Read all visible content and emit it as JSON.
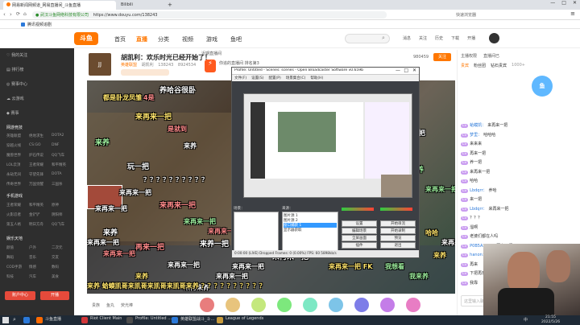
{
  "browser": {
    "tabs": [
      {
        "label": "网易新闻网频道_网易直播间_斗鱼直播"
      },
      {
        "label": "Bilibili"
      }
    ],
    "window_controls": {
      "minimize": "—",
      "maximize": "□",
      "close": "✕"
    },
    "address": {
      "url": "https://www.douyu.com/138243",
      "site_hint": "武汉斗鱼网络科技有限公司"
    },
    "right_hint": "快速浏览器",
    "bookmarks": [
      {
        "label": "腾讯视频追剧"
      }
    ]
  },
  "site": {
    "logo": "斗鱼",
    "nav": [
      "首页",
      "直播",
      "分类",
      "视频",
      "游戏",
      "鱼吧"
    ],
    "search_placeholder": "",
    "user_icons": [
      "消息",
      "关注",
      "历史",
      "下载",
      "开播"
    ]
  },
  "sidebar": {
    "items": [
      {
        "label": "我的关注"
      },
      {
        "label": "排行榜"
      },
      {
        "label": "赛事中心"
      },
      {
        "label": "云游戏"
      },
      {
        "label": "赛事"
      }
    ],
    "section_games": "网游竞技",
    "games": [
      [
        "英雄联盟",
        "绝地求生",
        "DOTA2"
      ],
      [
        "穿越火线",
        "CS:GO",
        "DNF"
      ],
      [
        "魔兽世界",
        "炉石传说",
        "QQ飞车"
      ],
      [
        "LOL云顶",
        "王者荣耀",
        "和平精英"
      ],
      [
        "永劫无间",
        "守望先锋",
        "DOTA"
      ],
      [
        "传奇世界",
        "万国觉醒",
        "三国杀"
      ]
    ],
    "section_mobile": "手机游戏",
    "mobile": [
      [
        "王者荣耀",
        "和平精英",
        "原神"
      ],
      [
        "火影忍者",
        "金铲铲",
        "阴阳师"
      ],
      [
        "第五人格",
        "明日方舟",
        "QQ飞车"
      ]
    ],
    "section_fun": "娱乐天地",
    "fun": [
      [
        "颜值",
        "户外",
        "二次元"
      ],
      [
        "舞蹈",
        "音乐",
        "交友"
      ],
      [
        "COD手游",
        "情感",
        "数码"
      ],
      [
        "科技",
        "汽车",
        "美食"
      ]
    ],
    "bottom_btn1": "账户中心",
    "bottom_btn2": "开播"
  },
  "room": {
    "avatar_text": "JJ",
    "title": "胡凯利：欢乐时光已经开始了！",
    "streamer": "胡凯利",
    "category": "英雄联盟",
    "room_id": "138243",
    "hot_value": "8924534",
    "follow_label": "关注",
    "rank_title": "近期直播间",
    "rank_sub": "你追的直播间 排名第3",
    "top_right_num": "980459",
    "share_label": "分享"
  },
  "danmaku": [
    "养哈谷很卧",
    "都是卧龙凤雏",
    "4是",
    "养一把 哈啊",
    "来",
    "来再来一把",
    "我再来一把",
    "来",
    "是就到",
    "来再来一把",
    "来养",
    "来养",
    "来再来一把",
    "来再来一把",
    "求你了",
    "玩一把",
    "来再来一把",
    "来再来一把",
    "拉满",
    "来再来一把",
    "来再来一把",
    "来再来一把",
    "来再来一把",
    "？？？？？？？？？？",
    "来再来一把",
    "再来一把",
    "来再来一把",
    "来再来一把",
    "来再来一把",
    "来再来一把 FK",
    "来养一把",
    "我想看",
    "来再来一把",
    "来养",
    "来再来一把",
    "来再来一把",
    "来再来一把",
    "来养",
    "我来养",
    "来再来养",
    "来养",
    "哈哈",
    "来再来一把",
    "来再来一把",
    "来再来",
    "来养",
    "来再来一把",
    "来再来一把",
    "来再来一把",
    "来再来一把",
    "再来一把",
    "来再来一把",
    "来再来一把",
    "来养 蛤蟆凯哥来凯哥来凯哥来凯哥来养 ？？？？？？？？？？"
  ],
  "obs": {
    "title": "Profile: Untitled - Scenes: scenes - Open Broadcaster Software v0.659b",
    "menu": [
      "文件(F)",
      "设置(S)",
      "配置(P)",
      "场景集合(C)",
      "帮助(H)"
    ],
    "scenes_label": "场景：",
    "sources_label": "来源：",
    "sources": [
      "图片源 1",
      "图片源 2",
      "窗口捕获 1",
      "显示器获取"
    ],
    "buttons": [
      "设置",
      "开始串流",
      "编辑场景",
      "开始录制",
      "全屏画面",
      "预览",
      "插件",
      "退出"
    ],
    "status": "0:00:00 (LIVE)   Dropped Frames: 0 (0.00%)   FPS: 60   5898kb/s",
    "fps": "60"
  },
  "chat": {
    "header_tabs": [
      "主播权限",
      "直播间已"
    ],
    "top_tabs": [
      "贵宾",
      "粉丝团",
      "钻石贵宾"
    ],
    "rank_tabs": [
      "1000+"
    ],
    "messages": [
      {
        "user": "蛤蟆凯",
        "text": "来再来一把"
      },
      {
        "user": "梦里",
        "text": "哈哈哈"
      },
      {
        "user": "",
        "text": "来来来"
      },
      {
        "user": "",
        "text": "再来一把"
      },
      {
        "user": "",
        "text": "养一把"
      },
      {
        "user": "",
        "text": "来再来一把"
      },
      {
        "user": "",
        "text": "哈哈"
      },
      {
        "user": "Lbdqrr",
        "text": "养哈"
      },
      {
        "user": "",
        "text": "来一把"
      },
      {
        "user": "Lbdqrr",
        "text": "来再来一把"
      },
      {
        "user": "",
        "text": "？？？"
      },
      {
        "user": "",
        "text": "溜啊"
      },
      {
        "user": "",
        "text": "老婆们都在人吗"
      },
      {
        "user": "P0B5A2A1",
        "text": "再来一把吧"
      },
      {
        "user": "hanon",
        "text": "再来一把"
      },
      {
        "user": "",
        "text": "再来"
      },
      {
        "user": "",
        "text": "下把再玩"
      },
      {
        "user": "",
        "text": "我靠"
      }
    ],
    "input_placeholder": "这里输入聊天内容",
    "send_label": "发送"
  },
  "gift_bar": {
    "labels": [
      "贵族",
      "鱼丸",
      "荧光棒",
      "礼物"
    ],
    "balance": "0",
    "count": "0.1"
  },
  "taskbar": {
    "items": [
      {
        "label": "",
        "color": "#2b79d9"
      },
      {
        "label": "斗鱼直播",
        "color": "#ff6a00"
      },
      {
        "label": "Riot Client Main",
        "color": "#d13639"
      },
      {
        "label": "Profile: Untitled ...",
        "color": "#4c4c4c"
      },
      {
        "label": "英雄联盟战斗_斗...",
        "color": "#2b79d9"
      },
      {
        "label": "League of Legends",
        "color": "#c89b3c"
      }
    ],
    "time": "21:55",
    "date": "2022/5/26",
    "tray": "中"
  },
  "colors": {
    "brand_orange": "#ff7700",
    "chat_purple": "#c99cf0",
    "sidebar_bg": "#2e2e2e",
    "taskbar_bg": "#1f2a36"
  }
}
